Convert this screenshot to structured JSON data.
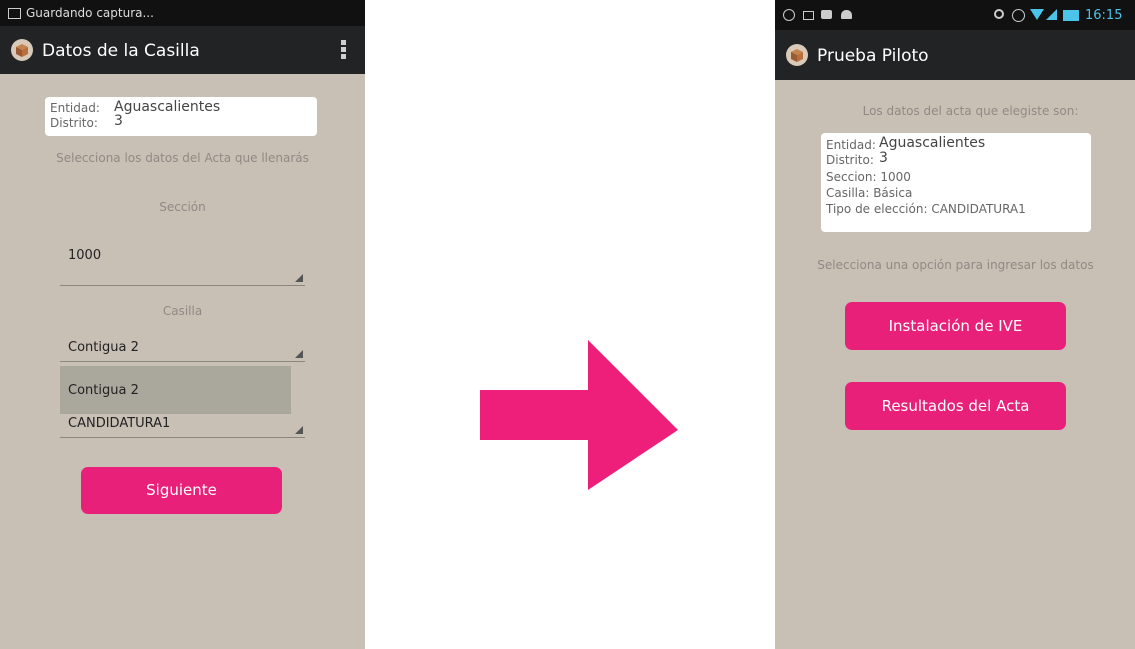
{
  "left_screen": {
    "status": {
      "notification_text": "Guardando captura..."
    },
    "action_bar": {
      "title": "Datos de la Casilla"
    },
    "info_card": {
      "entidad_label": "Entidad:",
      "entidad_value": "Aguascalientes",
      "distrito_label": "Distrito:",
      "distrito_value": "3"
    },
    "instruction": "Selecciona los datos del Acta que llenarás",
    "seccion_label": "Sección",
    "seccion_value": "1000",
    "casilla_label": "Casilla",
    "casilla_value": "Contigua 2",
    "dropdown_option": "Contigua 2",
    "tipo_value": "CANDIDATURA1",
    "next_button": "Siguiente"
  },
  "right_screen": {
    "status": {
      "time": "16:15"
    },
    "action_bar": {
      "title": "Prueba Piloto"
    },
    "intro": "Los datos del acta que elegiste son:",
    "summary": {
      "entidad_label": "Entidad:",
      "entidad_value": "Aguascalientes",
      "distrito_label": "Distrito:",
      "distrito_value": "3",
      "seccion": "Seccion: 1000",
      "casilla": "Casilla: Básica",
      "tipo": "Tipo de elección: CANDIDATURA1"
    },
    "prompt": "Selecciona una opción para ingresar los datos",
    "buttons": {
      "instalacion": "Instalación de IVE",
      "resultados": "Resultados del Acta"
    }
  },
  "colors": {
    "accent": "#e8207a",
    "screen_background": "#c9c0b5",
    "action_bar": "#222324",
    "status_bar": "#111111"
  },
  "icons": {
    "left_status": "image-icon",
    "app_logo": "box-logo-icon",
    "overflow": "overflow-menu-icon",
    "transition": "arrow-right-icon"
  }
}
